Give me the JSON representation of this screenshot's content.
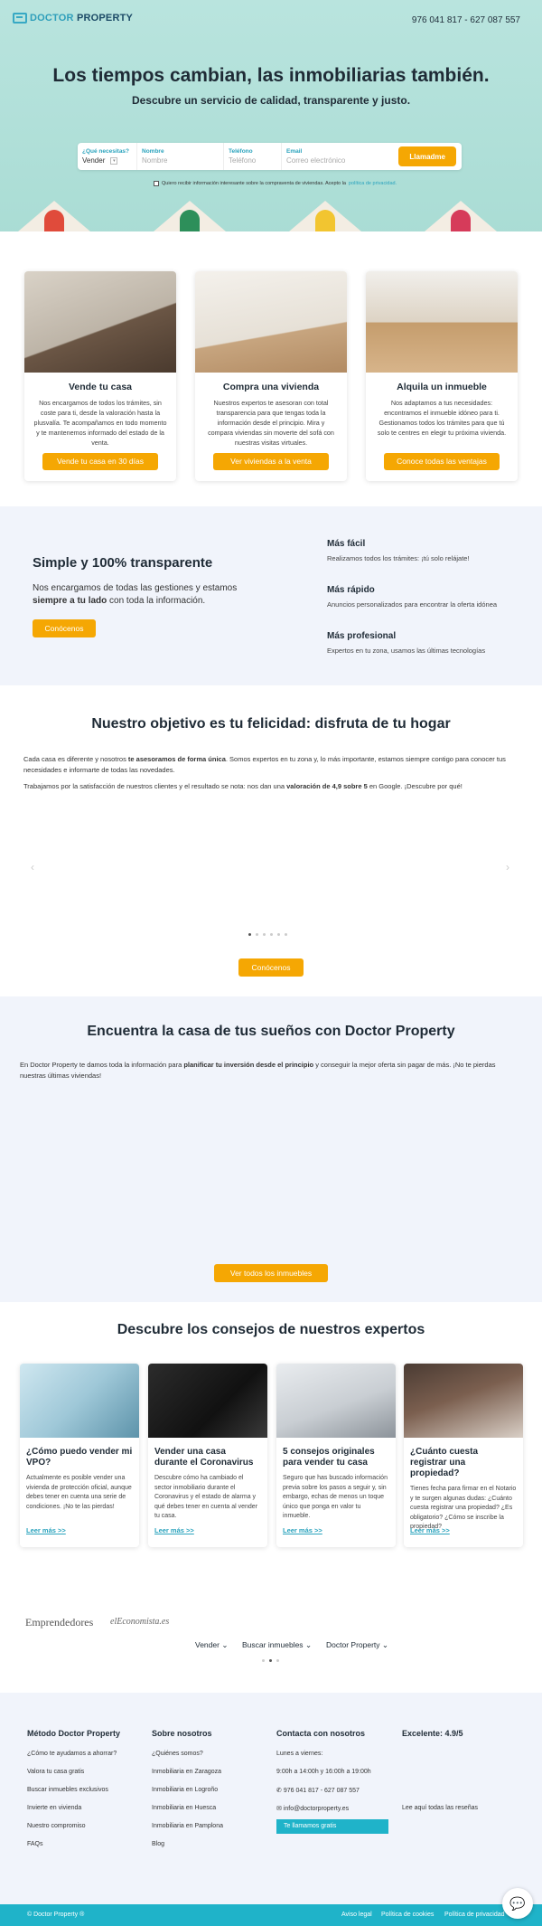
{
  "header": {
    "logo_doctor": "DOCTOR",
    "logo_property": "PROPERTY",
    "phones": "976 041 817 - 627 087 557",
    "title": "Los tiempos cambian, las inmobiliarias también.",
    "subtitle": "Descubre un servicio de calidad, transparente y justo.",
    "form": {
      "need_label": "¿Qué necesitas?",
      "need_value": "Vender",
      "name_label": "Nombre",
      "name_placeholder": "Nombre",
      "phone_label": "Teléfono",
      "phone_placeholder": "Teléfono",
      "email_label": "Email",
      "email_placeholder": "Correo electrónico",
      "submit": "Llamadme"
    },
    "consent_text": "Quiero recibir información interesante sobre la compraventa de viviendas. Acepto la",
    "consent_link": "política de privacidad."
  },
  "services": [
    {
      "title": "Vende tu casa",
      "text": "Nos encargamos de todos los trámites, sin coste para ti, desde la valoración hasta la plusvalía. Te acompañamos en todo momento y te mantenemos informado del estado de la venta.",
      "button": "Vende tu casa en 30 días"
    },
    {
      "title": "Compra una vivienda",
      "text": "Nuestros expertos te asesoran con total transparencia para que tengas toda la información desde el principio. Mira y compara viviendas sin moverte del sofá con nuestras visitas virtuales.",
      "button": "Ver viviendas a la venta"
    },
    {
      "title": "Alquila un inmueble",
      "text": "Nos adaptamos a tus necesidades: encontramos el inmueble idóneo para ti. Gestionamos todos los trámites para que tú solo te centres en elegir tu próxima vivienda.",
      "button": "Conoce todas las ventajas"
    }
  ],
  "transparent": {
    "title": "Simple y 100% transparente",
    "text_a": "Nos encargamos de todas las gestiones y estamos ",
    "text_b": "siempre a tu lado",
    "text_c": " con toda la información.",
    "button": "Conócenos",
    "features": [
      {
        "title": "Más fácil",
        "text": "Realizamos todos los trámites: ¡tú solo relájate!"
      },
      {
        "title": "Más rápido",
        "text": "Anuncios personalizados para encontrar la oferta idónea"
      },
      {
        "title": "Más profesional",
        "text": "Expertos en tu zona, usamos las últimas tecnologías"
      }
    ]
  },
  "happiness": {
    "title": "Nuestro objetivo es tu felicidad: disfruta de tu hogar",
    "p1_a": "Cada casa es diferente y nosotros ",
    "p1_b": "te asesoramos de forma única",
    "p1_c": ". Somos expertos en tu zona y, lo más importante, estamos siempre contigo para conocer tus necesidades e informarte de todas las novedades.",
    "p2_a": "Trabajamos por la satisfacción de nuestros clientes y el resultado se nota: nos dan una ",
    "p2_b": "valoración de 4,9 sobre 5",
    "p2_c": " en Google. ¡Descubre por qué!",
    "prev": "‹",
    "next": "›",
    "button": "Conócenos"
  },
  "dream": {
    "title": "Encuentra la casa de tus sueños con Doctor Property",
    "text_a": "En Doctor Property te damos toda la información para ",
    "text_b": "planificar tu inversión desde el principio",
    "text_c": " y conseguir la mejor oferta sin pagar de más. ¡No te pierdas nuestras últimas viviendas!",
    "button": "Ver todos los inmuebles"
  },
  "blog": {
    "title": "Descubre los consejos de nuestros expertos",
    "posts": [
      {
        "title": "¿Cómo puedo vender mi VPO?",
        "text": "Actualmente es posible vender una vivienda de protección oficial, aunque debes tener en cuenta una serie de condiciones. ¡No te las pierdas!",
        "more": "Leer más >>"
      },
      {
        "title": "Vender una casa durante el Coronavirus",
        "text": "Descubre cómo ha cambiado el sector inmobiliario durante el Coronavirus y el estado de alarma y qué debes tener en cuenta al vender tu casa.",
        "more": "Leer más >>"
      },
      {
        "title": "5 consejos originales para vender tu casa",
        "text": "Seguro que has buscado información previa sobre los pasos a seguir y, sin embargo, echas de menos un toque único que ponga en valor tu inmueble.",
        "more": "Leer más >>"
      },
      {
        "title": "¿Cuánto cuesta registrar una propiedad?",
        "text": "Tienes fecha para firmar en el Notario y te surgen algunas dudas: ¿Cuánto cuesta registrar una propiedad? ¿Es obligatorio? ¿Cómo se inscribe la propiedad?",
        "more": "Leer más >>"
      }
    ]
  },
  "press": {
    "logo1": "Emprendedores",
    "logo2": "elEconomista.es"
  },
  "nav": {
    "item1": "Vender",
    "item2": "Buscar inmuebles",
    "item3": "Doctor Property"
  },
  "footer": {
    "col1_title": "Método Doctor Property",
    "col1": [
      "¿Cómo te ayudamos a ahorrar?",
      "Valora tu casa gratis",
      "Buscar inmuebles exclusivos",
      "Invierte en vivienda",
      "Nuestro compromiso",
      "FAQs"
    ],
    "col2_title": "Sobre nosotros",
    "col2": [
      "¿Quiénes somos?",
      "Inmobiliaria en Zaragoza",
      "Inmobiliaria en Logroño",
      "Inmobiliaria en Huesca",
      "Inmobiliaria en Pamplona",
      "Blog"
    ],
    "col3_title": "Contacta con nosotros",
    "col3_days": "Lunes a viernes:",
    "col3_hours": "9:00h a 14:00h y 16:00h a 19:00h",
    "col3_phone": "976 041 817 - 627 087 557",
    "col3_email": "info@doctorproperty.es",
    "col3_button": "Te llamamos gratis",
    "col4_title": "Excelente: 4.9/5",
    "col4_link": "Lee aquí todas las reseñas",
    "copyright": "© Doctor Property ®",
    "legal": [
      "Aviso legal",
      "Política de cookies",
      "Política de privacidad"
    ]
  },
  "colors": {
    "accent": "#f5a703",
    "teal": "#1fb3c9",
    "mint": "#b9e4de"
  }
}
